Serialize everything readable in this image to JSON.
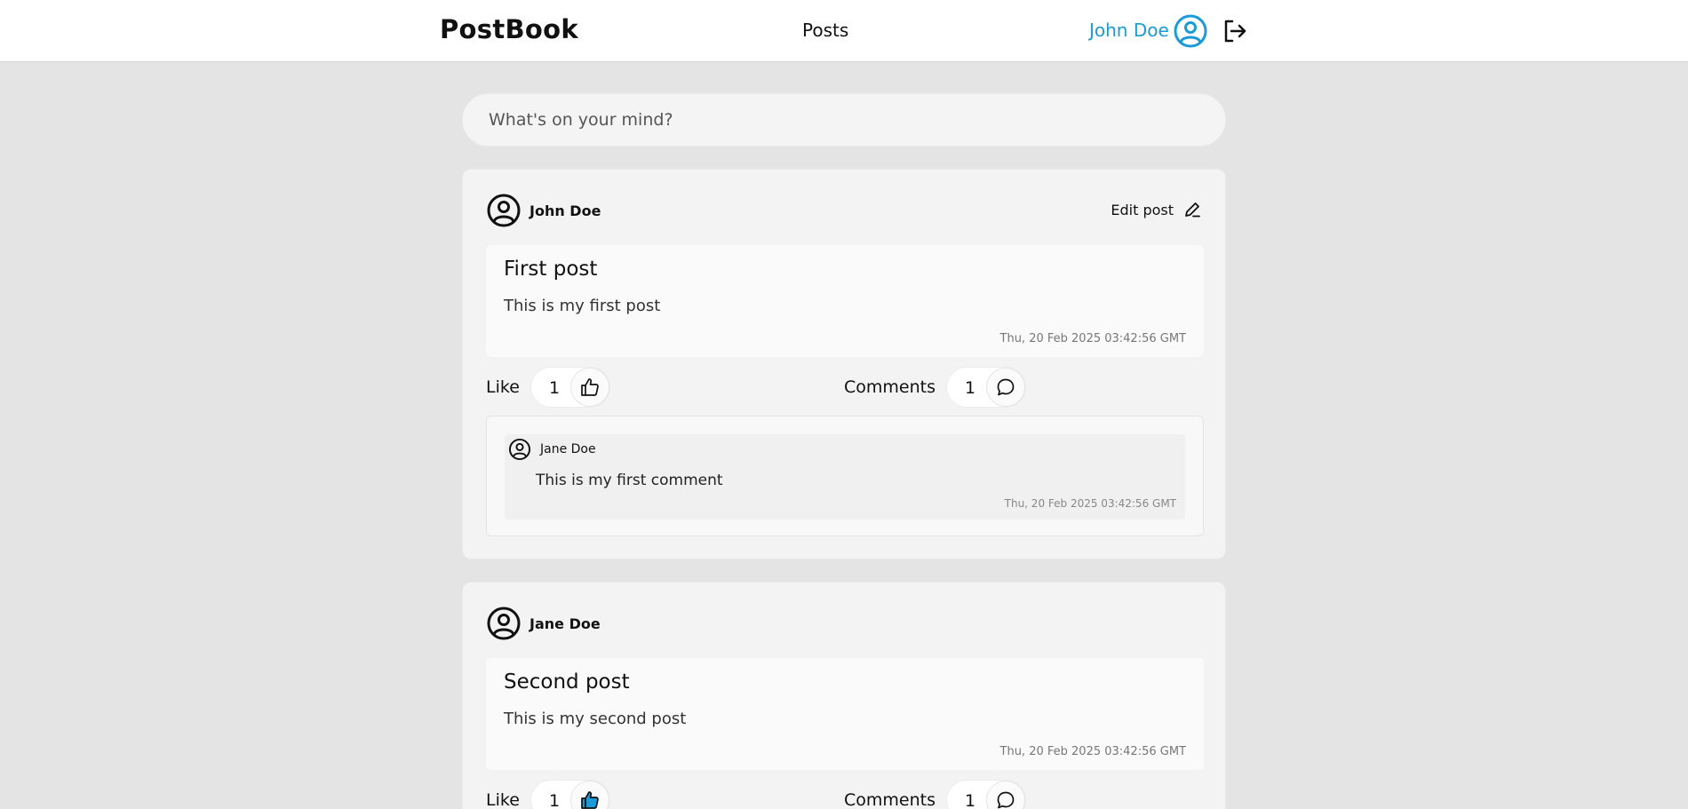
{
  "header": {
    "brand": "PostBook",
    "nav_posts": "Posts",
    "user_name": "John Doe",
    "accent_color": "#1a9bd7"
  },
  "composer": {
    "placeholder": "What's on your mind?"
  },
  "posts": [
    {
      "author": "John Doe",
      "edit_label": "Edit post",
      "title": "First post",
      "text": "This is my first post",
      "date": "Thu, 20 Feb 2025 03:42:56 GMT",
      "like_label": "Like",
      "like_count": "1",
      "liked": false,
      "comments_label": "Comments",
      "comments_count": "1",
      "comments": [
        {
          "author": "Jane Doe",
          "text": "This is my first comment",
          "date": "Thu, 20 Feb 2025 03:42:56 GMT"
        }
      ]
    },
    {
      "author": "Jane Doe",
      "title": "Second post",
      "text": "This is my second post",
      "date": "Thu, 20 Feb 2025 03:42:56 GMT",
      "like_label": "Like",
      "like_count": "1",
      "liked": true,
      "comments_label": "Comments",
      "comments_count": "1"
    }
  ]
}
